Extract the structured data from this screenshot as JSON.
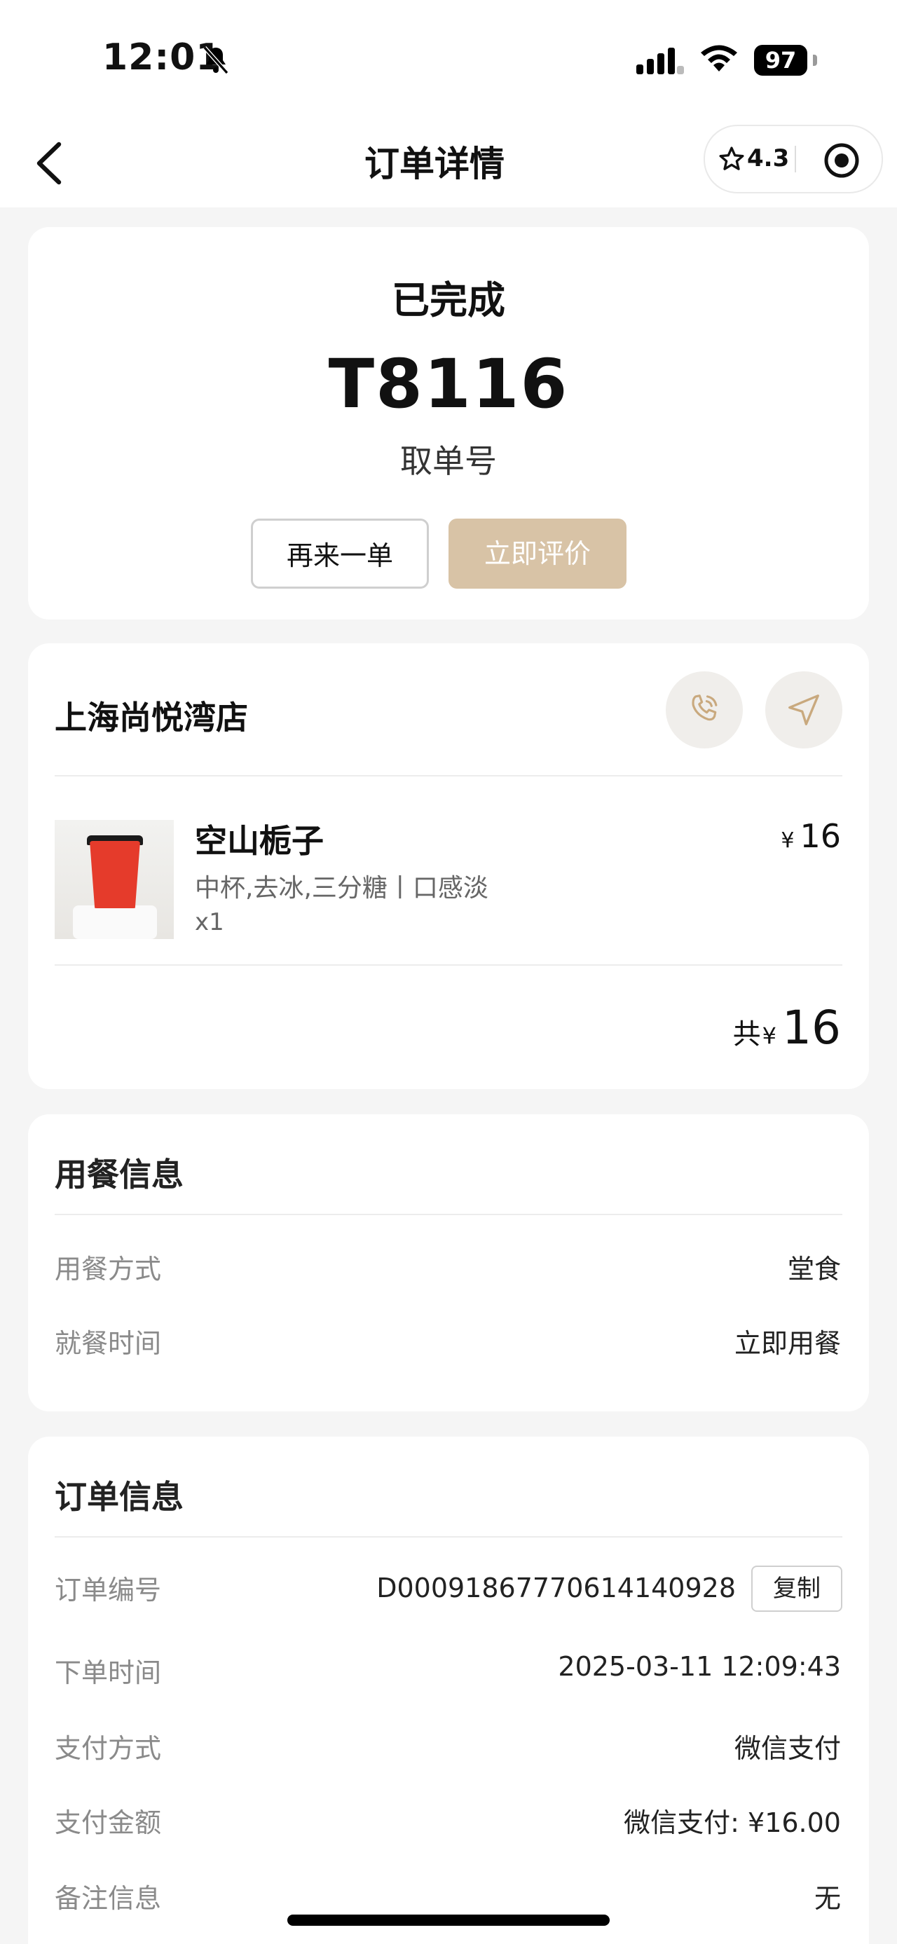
{
  "status_bar": {
    "time": "12:01",
    "battery": "97"
  },
  "nav": {
    "title": "订单详情",
    "rating": "4.3"
  },
  "order_status": {
    "status": "已完成",
    "pickup_code": "T8116",
    "pickup_label": "取单号",
    "reorder_label": "再来一单",
    "rate_label": "立即评价",
    "accent_color": "#d8c3a6"
  },
  "store": {
    "name": "上海尚悦湾店",
    "items": [
      {
        "name": "空山栀子",
        "options": "中杯,去冰,三分糖丨口感淡",
        "quantity": "x1",
        "currency": "¥",
        "price": "16"
      }
    ],
    "total_prefix": "共",
    "total_currency": "¥",
    "total": "16"
  },
  "dining": {
    "title": "用餐信息",
    "rows": [
      {
        "label": "用餐方式",
        "value": "堂食"
      },
      {
        "label": "就餐时间",
        "value": "立即用餐"
      }
    ]
  },
  "order_info": {
    "title": "订单信息",
    "copy_label": "复制",
    "rows": [
      {
        "label": "订单编号",
        "value": "D000918677706141409 28"
      },
      {
        "label": "下单时间",
        "value": "2025-03-11 12:09:43"
      },
      {
        "label": "支付方式",
        "value": "微信支付"
      },
      {
        "label": "支付金额",
        "value": "微信支付: ¥16.00"
      },
      {
        "label": "备注信息",
        "value": "无"
      }
    ]
  }
}
